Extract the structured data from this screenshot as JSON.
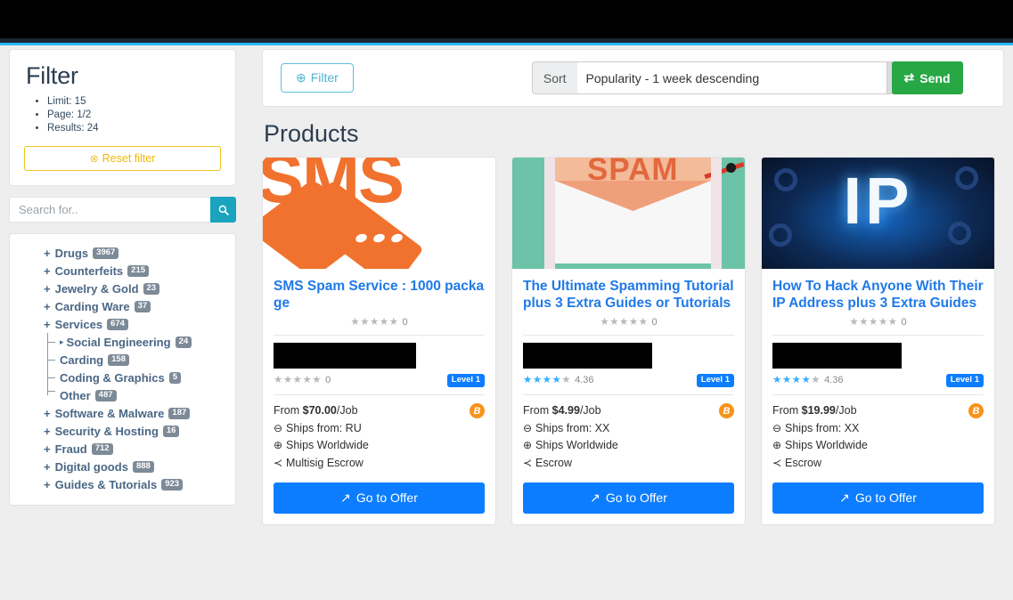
{
  "sidebar": {
    "filter_panel": {
      "title": "Filter",
      "stats": [
        "Limit: 15",
        "Page: 1/2",
        "Results: 24"
      ],
      "reset_label": "Reset filter",
      "reset_icon": "circle-x-icon"
    },
    "search": {
      "placeholder": "Search for..",
      "value": "",
      "button_icon": "search-icon"
    },
    "categories": [
      {
        "label": "Drugs",
        "count": "3967",
        "expander": "+",
        "level": 0
      },
      {
        "label": "Counterfeits",
        "count": "215",
        "expander": "+",
        "level": 0
      },
      {
        "label": "Jewelry & Gold",
        "count": "23",
        "expander": "+",
        "level": 0
      },
      {
        "label": "Carding Ware",
        "count": "37",
        "expander": "+",
        "level": 0
      },
      {
        "label": "Services",
        "count": "674",
        "expander": "+",
        "level": 0
      },
      {
        "label": "Social Engineering",
        "count": "24",
        "expander": "▸",
        "level": 1
      },
      {
        "label": "Carding",
        "count": "158",
        "expander": "",
        "level": 1
      },
      {
        "label": "Coding & Graphics",
        "count": "5",
        "expander": "",
        "level": 1
      },
      {
        "label": "Other",
        "count": "487",
        "expander": "",
        "level": 1,
        "last": true
      },
      {
        "label": "Software & Malware",
        "count": "187",
        "expander": "+",
        "level": 0
      },
      {
        "label": "Security & Hosting",
        "count": "16",
        "expander": "+",
        "level": 0
      },
      {
        "label": "Fraud",
        "count": "712",
        "expander": "+",
        "level": 0
      },
      {
        "label": "Digital goods",
        "count": "888",
        "expander": "+",
        "level": 0
      },
      {
        "label": "Guides & Tutorials",
        "count": "923",
        "expander": "+",
        "level": 0
      }
    ]
  },
  "toolbar": {
    "filter_label": "Filter",
    "filter_icon": "plus-circle-icon",
    "sort_label": "Sort",
    "sort_value": "Popularity - 1 week descending",
    "send_label": "Send",
    "send_icon": "transfer-arrows-icon"
  },
  "main": {
    "products_heading": "Products",
    "products": [
      {
        "thumb": "sms-spam-logo",
        "thumb_text": "SMS",
        "title": "SMS Spam Service : 1000 package",
        "rating_value": "0",
        "rating_stars_filled": 0,
        "vendor_name": "",
        "vendor_rating_value": "0",
        "vendor_stars_filled": 0,
        "level_badge": "Level 1",
        "price_prefix": "From",
        "price": "$70.00",
        "price_unit": "/Job",
        "ships_from": "Ships from: RU",
        "ships_to": "Ships Worldwide",
        "escrow": "Multisig Escrow",
        "currency_icon": "bitcoin-icon",
        "cta_label": "Go to Offer",
        "cta_icon": "arrow-up-right-icon"
      },
      {
        "thumb": "spam-envelope",
        "thumb_text": "SPAM",
        "title": "The Ultimate Spamming Tutorial plus 3 Extra Guides or Tutorials",
        "rating_value": "0",
        "rating_stars_filled": 0,
        "vendor_name": "",
        "vendor_rating_value": "4.36",
        "vendor_stars_filled": 4,
        "level_badge": "Level 1",
        "price_prefix": "From",
        "price": "$4.99",
        "price_unit": "/Job",
        "ships_from": "Ships from: XX",
        "ships_to": "Ships Worldwide",
        "escrow": "Escrow",
        "currency_icon": "bitcoin-icon",
        "cta_label": "Go to Offer",
        "cta_icon": "arrow-up-right-icon"
      },
      {
        "thumb": "ip-address",
        "thumb_text": "IP",
        "title": "How To Hack Anyone With Their IP Address plus 3 Extra Guides",
        "rating_value": "0",
        "rating_stars_filled": 0,
        "vendor_name": "",
        "vendor_rating_value": "4.36",
        "vendor_stars_filled": 4,
        "level_badge": "Level 1",
        "price_prefix": "From",
        "price": "$19.99",
        "price_unit": "/Job",
        "ships_from": "Ships from: XX",
        "ships_to": "Ships Worldwide",
        "escrow": "Escrow",
        "currency_icon": "bitcoin-icon",
        "cta_label": "Go to Offer",
        "cta_icon": "arrow-up-right-icon"
      }
    ]
  },
  "icons": {
    "ships_from": "⊖",
    "ships_to": "⊕",
    "escrow": "≺",
    "bitcoin": "B",
    "search": "⚲",
    "plus_circle": "⊕",
    "circle_x": "⊗",
    "send": "⇄",
    "cta_arrow": "↗"
  },
  "colors": {
    "accent_blue": "#0d7dff",
    "teal": "#1aa3bd",
    "green": "#28a745",
    "amber": "#f0b90b",
    "star_on": "#33b0ff",
    "badge_gray": "#7d8a97",
    "bitcoin_orange": "#f7931a"
  }
}
